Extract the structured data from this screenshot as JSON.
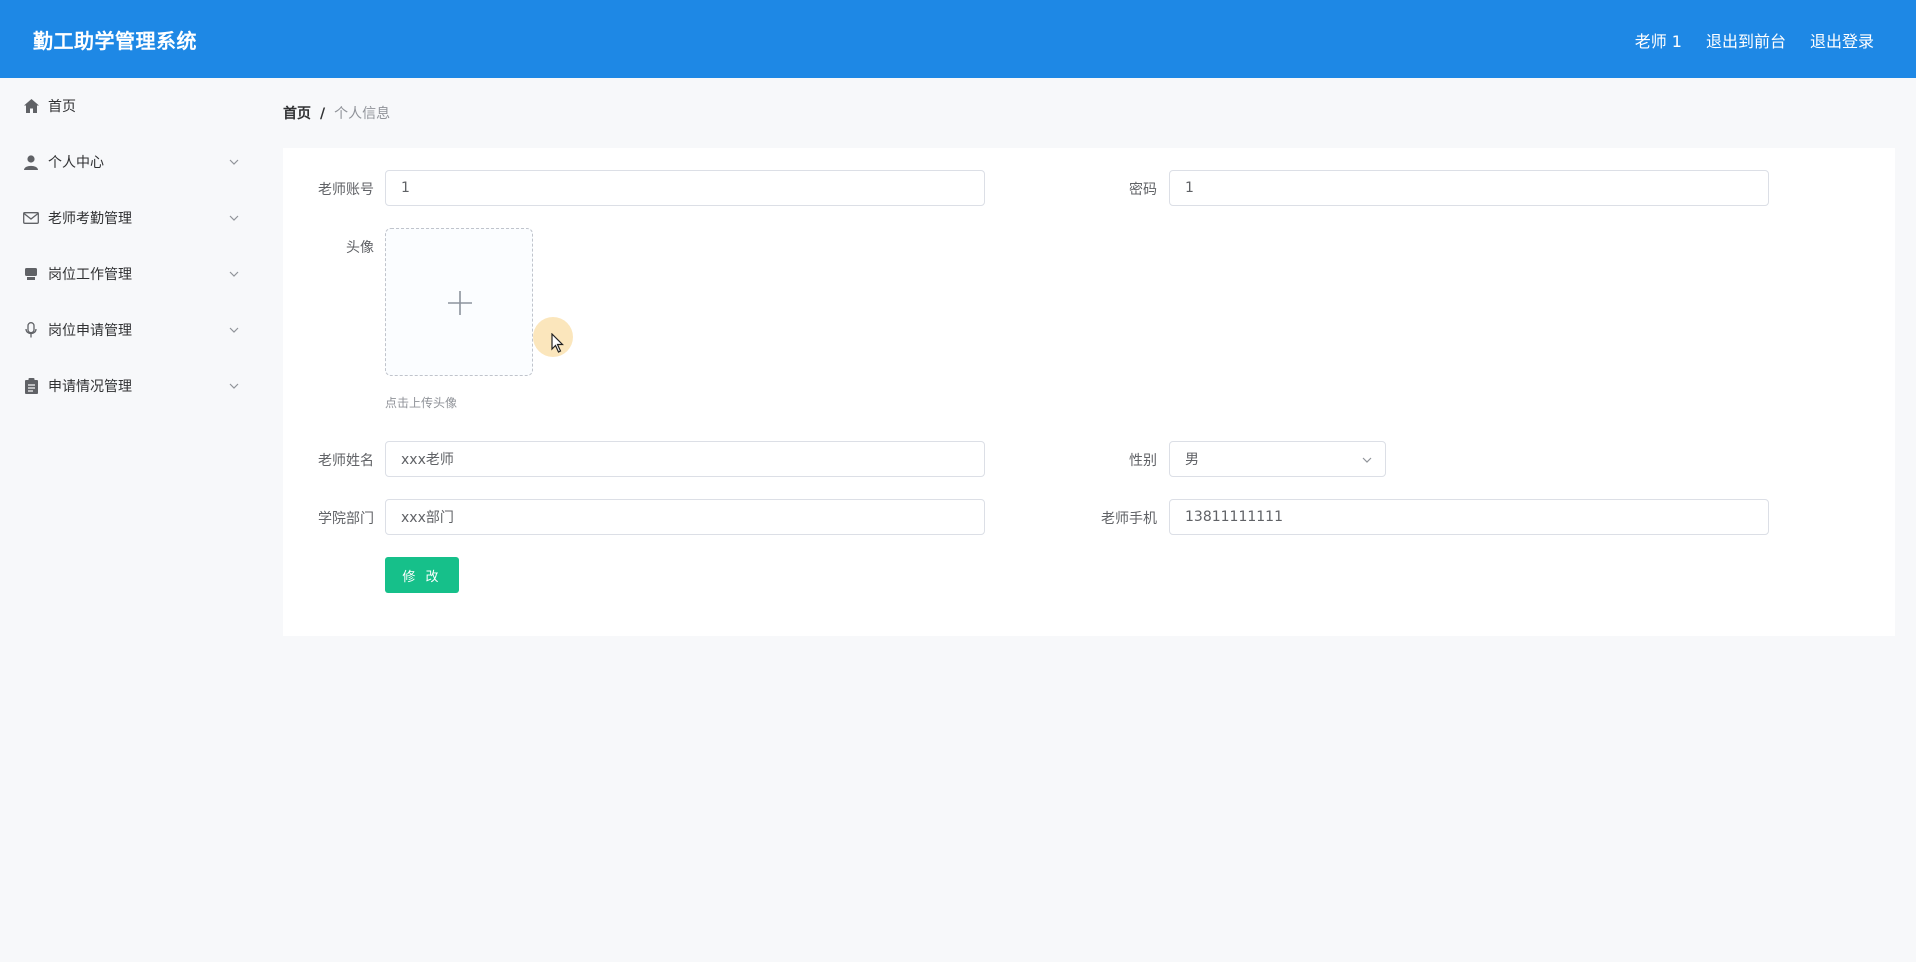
{
  "header": {
    "brand": "勤工助学管理系统",
    "user": "老师 1",
    "to_frontend": "退出到前台",
    "logout": "退出登录"
  },
  "sidebar": {
    "items": [
      {
        "label": "首页",
        "icon": "home-icon",
        "has_submenu": false
      },
      {
        "label": "个人中心",
        "icon": "user-icon",
        "has_submenu": true
      },
      {
        "label": "老师考勤管理",
        "icon": "mail-icon",
        "has_submenu": true
      },
      {
        "label": "岗位工作管理",
        "icon": "printer-icon",
        "has_submenu": true
      },
      {
        "label": "岗位申请管理",
        "icon": "microphone-icon",
        "has_submenu": true
      },
      {
        "label": "申请情况管理",
        "icon": "clipboard-icon",
        "has_submenu": true
      }
    ]
  },
  "breadcrumb": {
    "home": "首页",
    "separator": "/",
    "current": "个人信息"
  },
  "form": {
    "account_label": "老师账号",
    "account_value": "1",
    "password_label": "密码",
    "password_value": "1",
    "avatar_label": "头像",
    "avatar_hint": "点击上传头像",
    "name_label": "老师姓名",
    "name_value": "xxx老师",
    "gender_label": "性别",
    "gender_value": "男",
    "dept_label": "学院部门",
    "dept_value": "xxx部门",
    "phone_label": "老师手机",
    "phone_value": "13811111111",
    "submit_label": "修 改"
  },
  "colors": {
    "header_bg": "#1e88e5",
    "button_bg": "#16c08a"
  }
}
